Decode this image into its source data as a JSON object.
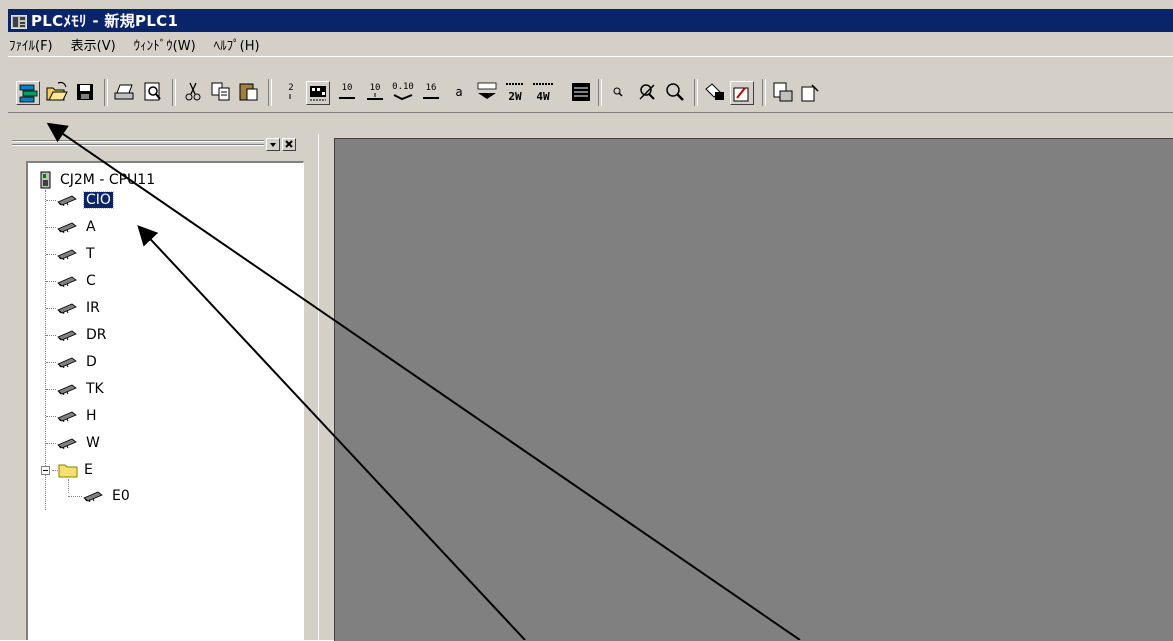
{
  "window": {
    "title": "PLCﾒﾓﾘ - 新規PLC1"
  },
  "menubar": {
    "items": [
      {
        "label": "ﾌｧｲﾙ(F)"
      },
      {
        "label": "表示(V)"
      },
      {
        "label": "ｳｨﾝﾄﾞｳ(W)"
      },
      {
        "label": "ﾍﾙﾌﾟ(H)"
      }
    ]
  },
  "toolbar": {
    "labels": {
      "bin": "2",
      "dec10": "10",
      "dec10s": "10",
      "bcd": "0.10",
      "hex16": "16",
      "ascii": "a",
      "word2": "2W",
      "word4": "4W"
    }
  },
  "tree": {
    "root": "CJ2M - CPU11",
    "areas": [
      "CIO",
      "A",
      "T",
      "C",
      "IR",
      "DR",
      "D",
      "TK",
      "H",
      "W"
    ],
    "folder": "E",
    "folder_children": [
      "E0"
    ],
    "selected": "CIO"
  },
  "colors": {
    "titlebar": "#0a246a",
    "workspace": "#808080",
    "face": "#d4d0c8"
  }
}
